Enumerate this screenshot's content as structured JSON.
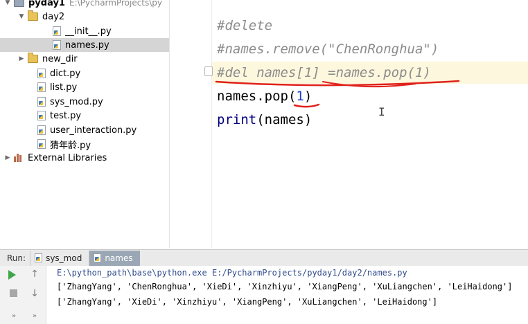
{
  "project_tree": {
    "root": {
      "name": "pyday1",
      "path": "E:\\PycharmProjects\\py"
    },
    "items": [
      {
        "label": "day2"
      },
      {
        "label": "__init__.py"
      },
      {
        "label": "names.py"
      },
      {
        "label": "new_dir"
      },
      {
        "label": "dict.py"
      },
      {
        "label": "list.py"
      },
      {
        "label": "sys_mod.py"
      },
      {
        "label": "test.py"
      },
      {
        "label": "user_interaction.py"
      },
      {
        "label": "猜年龄.py"
      },
      {
        "label": "External Libraries"
      }
    ]
  },
  "editor": {
    "lines": [
      {
        "text": "#delete"
      },
      {
        "text": "#names.remove(\"ChenRonghua\")"
      },
      {
        "text": "#del names[1] =names.pop(1)"
      },
      {
        "code_a": "names.pop(",
        "num": "1",
        "code_b": ")"
      },
      {
        "builtin": "print",
        "code": "(names)"
      }
    ]
  },
  "run_panel": {
    "title": "Run:",
    "tabs": [
      {
        "label": "sys_mod"
      },
      {
        "label": "names"
      }
    ],
    "output": [
      "E:\\python_path\\base\\python.exe E:/PycharmProjects/pyday1/day2/names.py",
      "['ZhangYang', 'ChenRonghua', 'XieDi', 'Xinzhiyu', 'XiangPeng', 'XuLiangchen', 'LeiHaidong']",
      "['ZhangYang', 'XieDi', 'Xinzhiyu', 'XiangPeng', 'XuLiangchen', 'LeiHaidong']"
    ]
  },
  "colors": {
    "annotation_red": "#e0211a",
    "comment_gray": "#8c8c8c",
    "number_blue": "#1c3fcf",
    "selected_row": "#d5d5d5"
  }
}
